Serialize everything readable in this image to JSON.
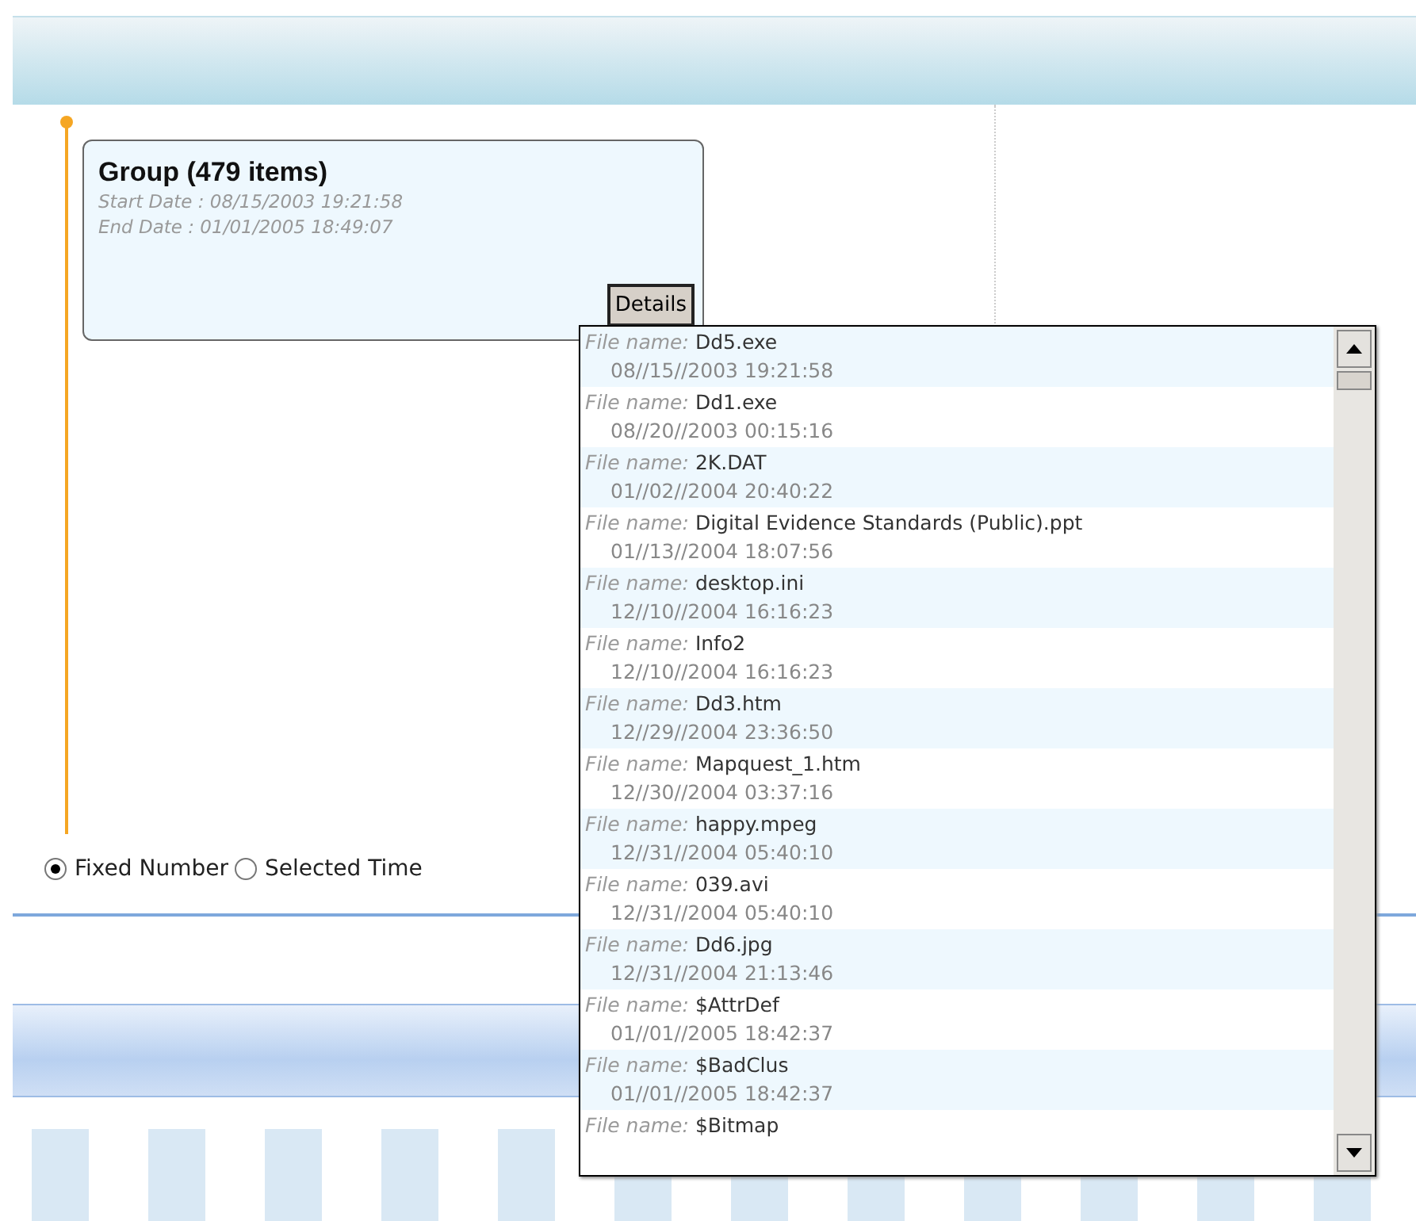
{
  "group": {
    "title": "Group (479 items)",
    "start_date": "Start Date : 08/15/2003 19:21:58",
    "end_date": "End Date : 01/01/2005 18:49:07",
    "details_button": "Details"
  },
  "details_list": [
    {
      "label": "File name:",
      "name": "Dd5.exe",
      "date": "08//15//2003 19:21:58"
    },
    {
      "label": "File name:",
      "name": "Dd1.exe",
      "date": "08//20//2003 00:15:16"
    },
    {
      "label": "File name:",
      "name": "2K.DAT",
      "date": "01//02//2004 20:40:22"
    },
    {
      "label": "File name:",
      "name": "Digital Evidence Standards (Public).ppt",
      "date": "01//13//2004 18:07:56"
    },
    {
      "label": "File name:",
      "name": "desktop.ini",
      "date": "12//10//2004 16:16:23"
    },
    {
      "label": "File name:",
      "name": "Info2",
      "date": "12//10//2004 16:16:23"
    },
    {
      "label": "File name:",
      "name": "Dd3.htm",
      "date": "12//29//2004 23:36:50"
    },
    {
      "label": "File name:",
      "name": "Mapquest_1.htm",
      "date": "12//30//2004 03:37:16"
    },
    {
      "label": "File name:",
      "name": "happy.mpeg",
      "date": "12//31//2004 05:40:10"
    },
    {
      "label": "File name:",
      "name": "039.avi",
      "date": "12//31//2004 05:40:10"
    },
    {
      "label": "File name:",
      "name": "Dd6.jpg",
      "date": "12//31//2004 21:13:46"
    },
    {
      "label": "File name:",
      "name": "$AttrDef",
      "date": "01//01//2005 18:42:37"
    },
    {
      "label": "File name:",
      "name": "$BadClus",
      "date": "01//01//2005 18:42:37"
    },
    {
      "label": "File name:",
      "name": "$Bitmap"
    }
  ],
  "range_mode": [
    {
      "label": "Fixed Number",
      "selected": true
    },
    {
      "label": "Selected Time",
      "selected": false
    }
  ]
}
